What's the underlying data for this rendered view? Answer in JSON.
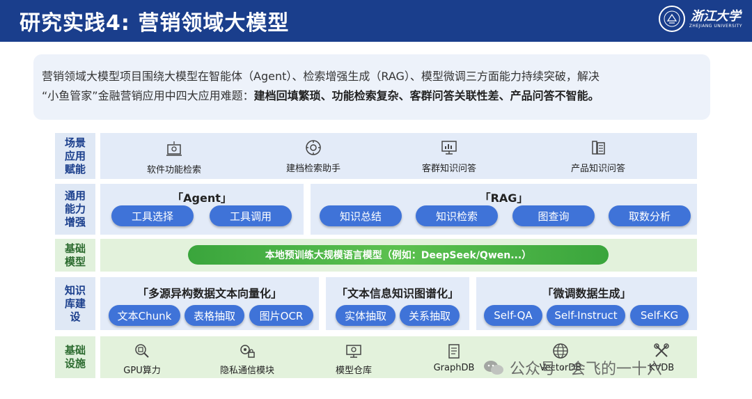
{
  "header": {
    "title": "研究实践4: 营销领域大模型",
    "logo_cn": "浙江大学",
    "logo_en": "ZHEJIANG UNIVERSITY"
  },
  "intro": {
    "line1": "营销领域大模型项目围绕大模型在智能体（Agent）、检索增强生成（RAG）、模型微调三方面能力持续突破，解决",
    "line2_prefix": "“小鱼管家”金融营销应用中四大应用难题：",
    "line2_bold": "建档回填繁琐、功能检索复杂、客群问答关联性差、产品问答不智能。"
  },
  "layers": {
    "scene": {
      "label": "场景\n应用\n赋能",
      "items": [
        {
          "label": "软件功能检索",
          "icon": "software-search-icon"
        },
        {
          "label": "建档检索助手",
          "icon": "gear-search-icon"
        },
        {
          "label": "客群知识问答",
          "icon": "monitor-chart-icon"
        },
        {
          "label": "产品知识问答",
          "icon": "phone-doc-icon"
        }
      ]
    },
    "general": {
      "label": "通用\n能力\n增强",
      "agent": {
        "title": "「Agent」",
        "pills": [
          "工具选择",
          "工具调用"
        ]
      },
      "rag": {
        "title": "「RAG」",
        "pills": [
          "知识总结",
          "知识检索",
          "图查询",
          "取数分析"
        ]
      }
    },
    "base_model": {
      "label": "基础\n模型",
      "bar": "本地预训练大规模语言模型（例如：DeepSeek/Qwen...）"
    },
    "knowledge": {
      "label": "知识\n库建\n设",
      "groups": [
        {
          "title": "「多源异构数据文本向量化」",
          "pills": [
            "文本Chunk",
            "表格抽取",
            "图片OCR"
          ]
        },
        {
          "title": "「文本信息知识图谱化」",
          "pills": [
            "实体抽取",
            "关系抽取"
          ]
        },
        {
          "title": "「微调数据生成」",
          "pills": [
            "Self-QA",
            "Self-Instruct",
            "Self-KG"
          ]
        }
      ]
    },
    "infra": {
      "label": "基础\n设施",
      "items": [
        {
          "label": "GPU算力",
          "icon": "gpu-icon"
        },
        {
          "label": "隐私通信模块",
          "icon": "privacy-gear-icon"
        },
        {
          "label": "模型仓库",
          "icon": "model-repo-icon"
        },
        {
          "label": "GraphDB",
          "icon": "graphdb-icon"
        },
        {
          "label": "VectorDB",
          "icon": "globe-icon"
        },
        {
          "label": "KVDB",
          "icon": "tools-icon"
        }
      ]
    }
  },
  "watermark": {
    "text": "公众号 · 会飞的一十六"
  },
  "colors": {
    "header_bg": "#1a3e8c",
    "pill_bg": "#3f73d8",
    "model_bar": "#4cb547",
    "panel_blue": "#e3ebf8",
    "panel_green": "#e3f2dc"
  }
}
